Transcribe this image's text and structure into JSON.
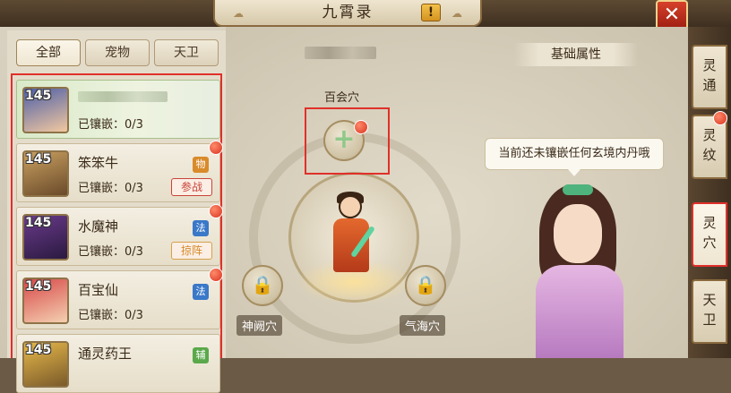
{
  "window": {
    "title": "九霄录",
    "help_label": "!",
    "close_label": "✕"
  },
  "filters": [
    {
      "label": "全部",
      "active": true
    },
    {
      "label": "宠物",
      "active": false
    },
    {
      "label": "天卫",
      "active": false
    }
  ],
  "pets": [
    {
      "level": "145",
      "name": "",
      "inlay": "已镶嵌：0/3",
      "active": true
    },
    {
      "level": "145",
      "name": "笨笨牛",
      "inlay": "已镶嵌：0/3",
      "role": "物",
      "status": "参战"
    },
    {
      "level": "145",
      "name": "水魔神",
      "inlay": "已镶嵌：0/3",
      "role": "法",
      "status": "掠阵"
    },
    {
      "level": "145",
      "name": "百宝仙",
      "inlay": "已镶嵌：0/3",
      "role": "法"
    },
    {
      "level": "145",
      "name": "通灵药王",
      "role": "辅"
    }
  ],
  "acupoints": {
    "top": "百会穴",
    "left": "神阙穴",
    "right": "气海穴"
  },
  "attributes": {
    "title": "基础属性"
  },
  "npc_hint": "当前还未镶嵌任何玄境内丹哦",
  "side_tabs": [
    {
      "label": "灵\n通"
    },
    {
      "label": "灵\n纹"
    },
    {
      "label": "灵\n穴",
      "active": true
    },
    {
      "label": "天\n卫"
    }
  ]
}
